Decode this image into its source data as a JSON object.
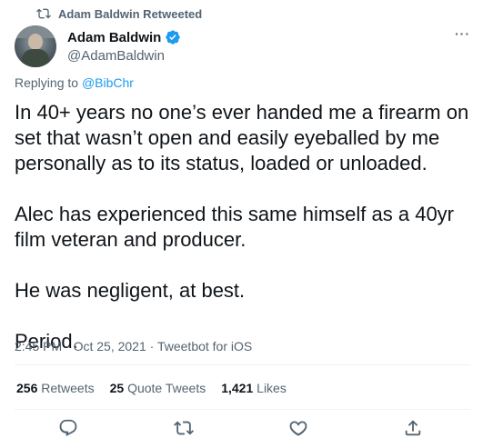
{
  "retweet": {
    "icon": "retweet-icon",
    "label": "Adam Baldwin Retweeted"
  },
  "author": {
    "display_name": "Adam Baldwin",
    "handle": "@AdamBaldwin",
    "verified_icon": "verified-badge-icon",
    "verified_color": "#1d9bf0"
  },
  "reply": {
    "prefix": "Replying to ",
    "to": "@BibChr"
  },
  "tweet": {
    "paragraphs": [
      "In 40+ years no one’s ever handed me a firearm on set that wasn’t open and easily eyeballed by me personally as to its status, loaded or unloaded.",
      "Alec has experienced this same himself as a 40yr film veteran and producer.",
      "He was negligent, at best.",
      "Period."
    ]
  },
  "meta": {
    "time": "2:45 PM",
    "sep": " · ",
    "date": "Oct 25, 2021",
    "source": "Tweetbot for iOS"
  },
  "stats": {
    "retweets_count": "256",
    "retweets_label": "Retweets",
    "quotes_count": "25",
    "quotes_label": "Quote Tweets",
    "likes_count": "1,421",
    "likes_label": "Likes"
  },
  "actions": [
    "reply-icon",
    "retweet-icon",
    "like-icon",
    "share-icon"
  ],
  "colors": {
    "text": "#0f1419",
    "secondary": "#536471",
    "link": "#1d9bf0",
    "divider": "#eff3f4"
  }
}
